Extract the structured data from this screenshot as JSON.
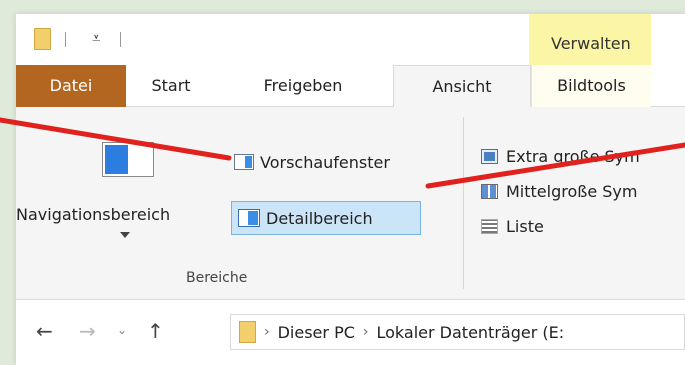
{
  "quick_access": {
    "separator": "|",
    "customize_arrow": "⩡"
  },
  "contextual": {
    "group_label": "Verwalten"
  },
  "tabs": [
    {
      "label": "Datei"
    },
    {
      "label": "Start"
    },
    {
      "label": "Freigeben"
    },
    {
      "label": "Ansicht"
    },
    {
      "label": "Bildtools"
    }
  ],
  "ribbon": {
    "navigation_pane_label": "Navigationsbereich",
    "preview_pane_label": "Vorschaufenster",
    "details_pane_label": "Detailbereich",
    "group_label": "Bereiche",
    "layout_items": [
      {
        "label": "Extra große Sym"
      },
      {
        "label": "Mittelgroße Sym"
      },
      {
        "label": "Liste"
      }
    ]
  },
  "address": {
    "back": "←",
    "forward": "→",
    "recent": "⌄",
    "up": "↑",
    "path": [
      {
        "label": "Dieser PC"
      },
      {
        "label": "Lokaler Datenträger (E:"
      }
    ],
    "chevron": "›"
  },
  "colors": {
    "datei_tab": "#b3661f",
    "verwalten_bg": "#faf6a5",
    "selected_button_bg": "#cce4f7",
    "callout_line": "#e0211d"
  }
}
